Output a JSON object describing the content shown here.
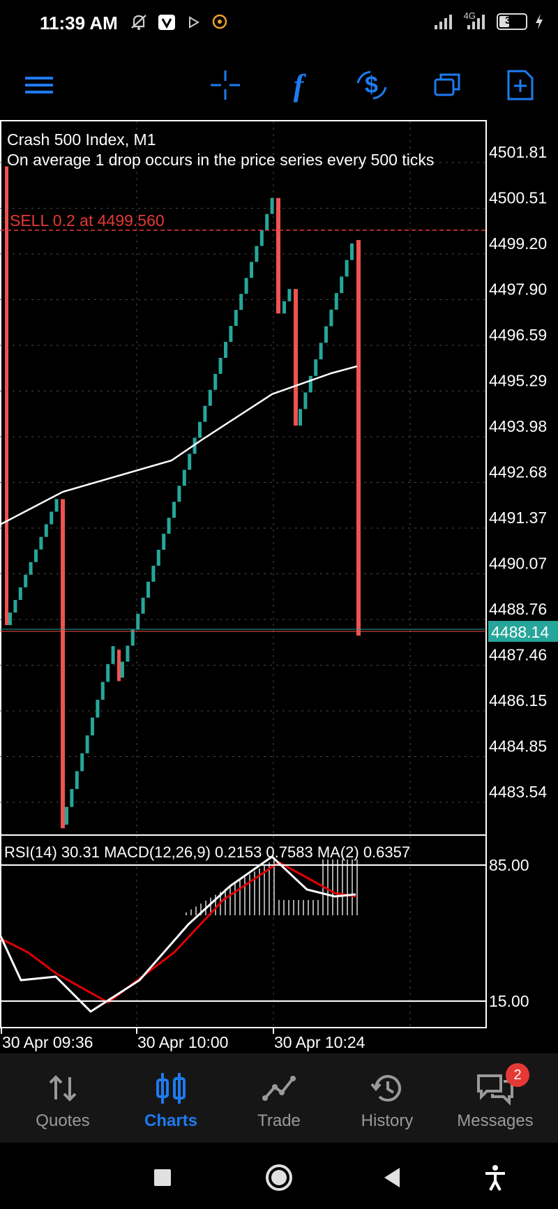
{
  "status_bar": {
    "time": "11:39 AM",
    "network": "4G",
    "battery": "36"
  },
  "toolbar": {
    "icons": [
      "menu-icon",
      "crosshair-icon",
      "indicators-icon",
      "trade-icon",
      "windows-icon",
      "new-order-icon"
    ],
    "indicator_glyph": "f"
  },
  "chart": {
    "symbol": "Crash 500 Index, M1",
    "description": "On average 1 drop occurs in the price series every 500 ticks",
    "order_line": "SELL 0.2 at 4499.560",
    "current_price": "4488.14",
    "price_labels": [
      "4501.81",
      "4500.51",
      "4499.20",
      "4497.90",
      "4496.59",
      "4495.29",
      "4493.98",
      "4492.68",
      "4491.37",
      "4490.07",
      "4488.76",
      "4487.46",
      "4486.15",
      "4484.85",
      "4483.54"
    ],
    "indicator_header": "RSI(14) 30.31 MACD(12,26,9) 0.2153 0.7583 MA(2) 0.6357",
    "indicator_levels": [
      "85.00",
      "15.00"
    ],
    "time_labels": [
      "30 Apr 09:36",
      "30 Apr 10:00",
      "30 Apr 10:24"
    ],
    "colors": {
      "bull": "#26a69a",
      "bear": "#ef5350",
      "order": "#e53935",
      "ma": "#ffffff",
      "signal": "#e00000",
      "accent": "#1e7bf0"
    }
  },
  "bottom_nav": {
    "items": [
      {
        "label": "Quotes",
        "icon": "quotes-icon"
      },
      {
        "label": "Charts",
        "icon": "charts-icon",
        "active": true
      },
      {
        "label": "Trade",
        "icon": "trade-icon"
      },
      {
        "label": "History",
        "icon": "history-icon"
      },
      {
        "label": "Messages",
        "icon": "messages-icon",
        "badge": "2"
      }
    ]
  },
  "system_nav": [
    "recents-icon",
    "home-icon",
    "back-icon",
    "accessibility-icon"
  ]
}
